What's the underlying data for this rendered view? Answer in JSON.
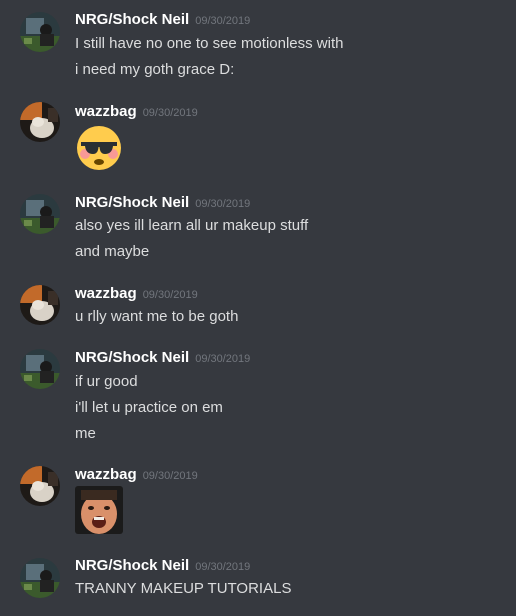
{
  "messages": [
    {
      "username": "NRG/Shock Neil",
      "timestamp": "09/30/2019",
      "lines": [
        "I still have no one to see motionless with",
        "i need my goth grace D:"
      ]
    },
    {
      "username": "wazzbag",
      "timestamp": "09/30/2019",
      "emoji": "flushed-sunglasses-emoji"
    },
    {
      "username": "NRG/Shock Neil",
      "timestamp": "09/30/2019",
      "lines": [
        "also yes ill learn all ur makeup stuff",
        "and maybe"
      ]
    },
    {
      "username": "wazzbag",
      "timestamp": "09/30/2019",
      "lines": [
        "u rlly want me to be goth"
      ]
    },
    {
      "username": "NRG/Shock Neil",
      "timestamp": "09/30/2019",
      "lines": [
        "if ur good",
        "i'll let u practice on em",
        "me"
      ]
    },
    {
      "username": "wazzbag",
      "timestamp": "09/30/2019",
      "emoji": "shocked-face-emote"
    },
    {
      "username": "NRG/Shock Neil",
      "timestamp": "09/30/2019",
      "lines": [
        "TRANNY MAKEUP TUTORIALS"
      ]
    }
  ],
  "colors": {
    "background": "#36393f",
    "username": "#ffffff",
    "timestamp": "#72767d",
    "text": "#dcddde"
  }
}
